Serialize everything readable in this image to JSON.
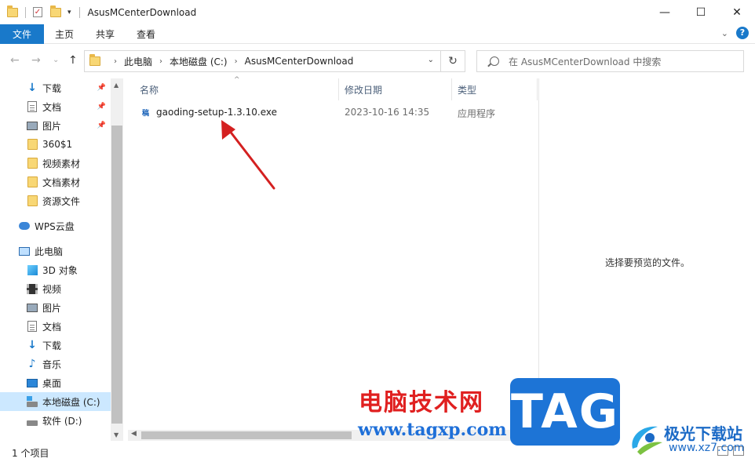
{
  "titlebar": {
    "title": "AsusMCenterDownload",
    "quick_access_dropdown": "▾",
    "minimize": "—",
    "maximize": "☐",
    "close": "✕"
  },
  "ribbon": {
    "tabs": [
      "文件",
      "主页",
      "共享",
      "查看"
    ],
    "expand_chevron": "⌄",
    "help": "?"
  },
  "address": {
    "back": "←",
    "forward": "→",
    "recent": "⌄",
    "up": "↑",
    "breadcrumbs": [
      "此电脑",
      "本地磁盘 (C:)",
      "AsusMCenterDownload"
    ],
    "separator": "›",
    "dropdown": "⌄",
    "refresh": "↻",
    "search_placeholder": "在 AsusMCenterDownload 中搜索"
  },
  "sidebar": {
    "quick_access": [
      {
        "label": "下载",
        "icon": "download-icon",
        "pinned": true
      },
      {
        "label": "文档",
        "icon": "document-icon",
        "pinned": true
      },
      {
        "label": "图片",
        "icon": "picture-icon",
        "pinned": true
      },
      {
        "label": "360$1",
        "icon": "folder-icon",
        "pinned": false
      },
      {
        "label": "视频素材",
        "icon": "folder-icon",
        "pinned": false
      },
      {
        "label": "文档素材",
        "icon": "folder-icon",
        "pinned": false
      },
      {
        "label": "资源文件",
        "icon": "folder-icon",
        "pinned": false
      }
    ],
    "wps": "WPS云盘",
    "this_pc": "此电脑",
    "pc_items": [
      {
        "label": "3D 对象",
        "icon": "3d-objects-icon"
      },
      {
        "label": "视频",
        "icon": "video-icon"
      },
      {
        "label": "图片",
        "icon": "picture-icon"
      },
      {
        "label": "文档",
        "icon": "document-icon"
      },
      {
        "label": "下载",
        "icon": "download-icon"
      },
      {
        "label": "音乐",
        "icon": "music-icon"
      },
      {
        "label": "桌面",
        "icon": "desktop-icon"
      },
      {
        "label": "本地磁盘 (C:)",
        "icon": "drive-c-icon",
        "selected": true
      },
      {
        "label": "软件 (D:)",
        "icon": "drive-d-icon"
      }
    ]
  },
  "columns": {
    "name": "名称",
    "date": "修改日期",
    "type": "类型"
  },
  "files": [
    {
      "name": "gaoding-setup-1.3.10.exe",
      "date": "2023-10-16 14:35",
      "type": "应用程序",
      "icon_text": "稿"
    }
  ],
  "preview": {
    "empty_text": "选择要预览的文件。"
  },
  "status": {
    "item_count": "1 个项目"
  },
  "watermark": {
    "site_name": "电脑技术网",
    "tag": "TAG",
    "url": "www.tagxp.com",
    "brand": "极光下载站",
    "brand_url": "www.xz7.com"
  },
  "colors": {
    "accent": "#1979ca",
    "selected_bg": "#cce8ff",
    "arrow": "#d42020"
  }
}
